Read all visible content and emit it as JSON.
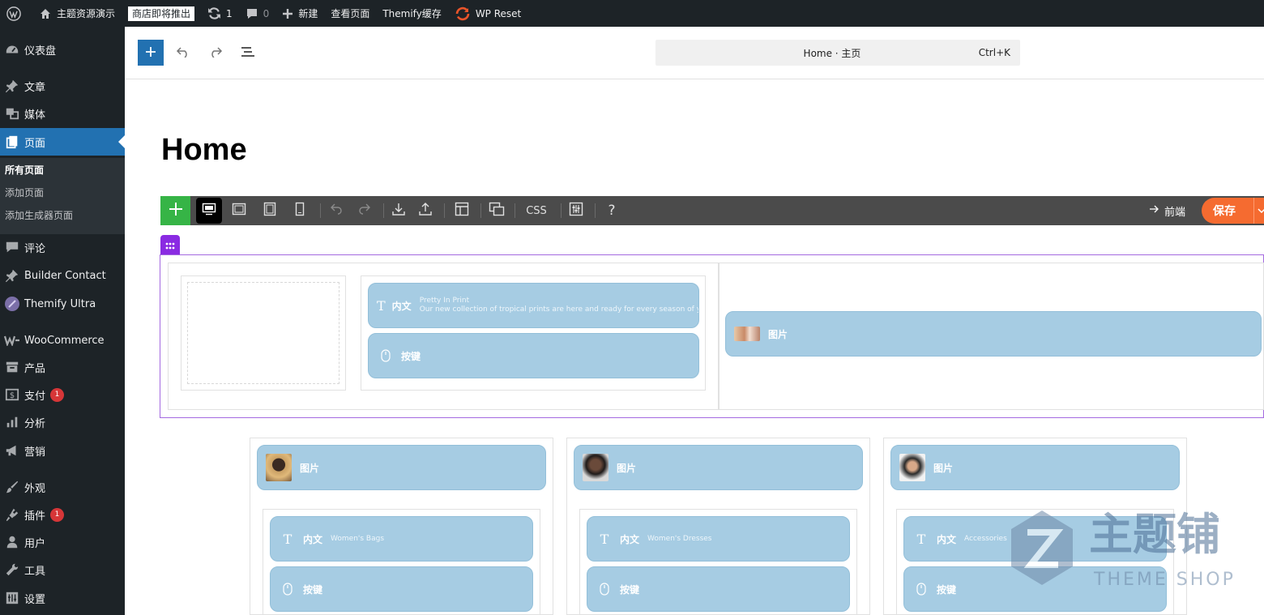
{
  "admin_bar": {
    "site_name": "主题资源演示",
    "coming_soon": "商店即将推出",
    "updates_count": "1",
    "comments_count": "0",
    "new_label": "新建",
    "view_page": "查看页面",
    "themify_cache": "Themify缓存",
    "wp_reset": "WP Reset"
  },
  "sidebar": {
    "items": [
      {
        "label": "仪表盘",
        "icon": "dashboard-icon"
      },
      {
        "label": "文章",
        "icon": "pin-icon"
      },
      {
        "label": "媒体",
        "icon": "media-icon"
      },
      {
        "label": "页面",
        "icon": "pages-icon"
      },
      {
        "label": "评论",
        "icon": "comment-icon"
      },
      {
        "label": "Builder Contact",
        "icon": "pin-icon"
      },
      {
        "label": "Themify Ultra",
        "icon": "themify-icon"
      },
      {
        "label": "WooCommerce",
        "icon": "woo-icon"
      },
      {
        "label": "产品",
        "icon": "archive-icon"
      },
      {
        "label": "支付",
        "icon": "money-icon",
        "badge": "1"
      },
      {
        "label": "分析",
        "icon": "chart-icon"
      },
      {
        "label": "营销",
        "icon": "megaphone-icon"
      },
      {
        "label": "外观",
        "icon": "brush-icon"
      },
      {
        "label": "插件",
        "icon": "plugin-icon",
        "badge": "1"
      },
      {
        "label": "用户",
        "icon": "user-icon"
      },
      {
        "label": "工具",
        "icon": "wrench-icon"
      },
      {
        "label": "设置",
        "icon": "settings-icon"
      }
    ],
    "submenu": [
      "所有页面",
      "添加页面",
      "添加生成器页面"
    ]
  },
  "editor": {
    "command_title": "Home · 主页",
    "command_shortcut": "Ctrl+K",
    "page_title": "Home"
  },
  "builder_toolbar": {
    "css_label": "CSS",
    "help_label": "?",
    "frontend_label": "前端",
    "save_label": "保存"
  },
  "modules": {
    "text_label": "内文",
    "button_label": "按键",
    "image_label": "图片",
    "row1_text_title": "Pretty In Print",
    "row1_text_body": "Our new collection of tropical prints are here and ready for every season of y",
    "col_texts": [
      "Women's Bags",
      "Women's Dresses",
      "Accessories"
    ]
  },
  "watermark": {
    "main": "主题铺",
    "sub": "THEME SHOP"
  },
  "colors": {
    "admin_bg": "#1d2327",
    "accent": "#2271b1",
    "builder_add": "#36b446",
    "save": "#f56b30",
    "row_outline": "#8a2be2",
    "module_bg": "#a6cce3"
  }
}
